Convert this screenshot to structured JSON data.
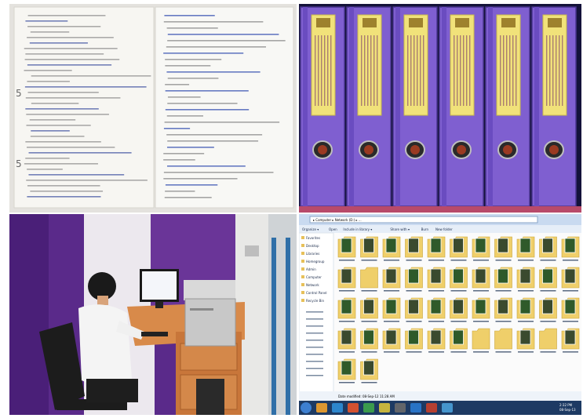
{
  "panels": {
    "documents": {
      "subject": "handwritten forms"
    },
    "binders": {
      "count": 6,
      "binder_color": "#7f5fd0",
      "label_color": "#f1e27a"
    },
    "office": {
      "subject": "person at computer desk"
    },
    "explorer": {
      "breadcrumb": "▸ Computer ▸ Network (D:) ▸ ...",
      "toolbar": [
        "Organize ▾",
        "Open",
        "Include in library ▾",
        "Share with ▾",
        "Burn",
        "New folder"
      ],
      "sidebar": [
        "Favorites",
        "Desktop",
        "Libraries",
        "Homegroup",
        "Admin",
        "Computer",
        "Network",
        "Control Panel",
        "Recycle Bin"
      ],
      "status": "Date modified: 08-Sep-12 11:28 AM",
      "taskbar_time": "2:32 PM",
      "taskbar_date": "08-Sep-13"
    }
  }
}
